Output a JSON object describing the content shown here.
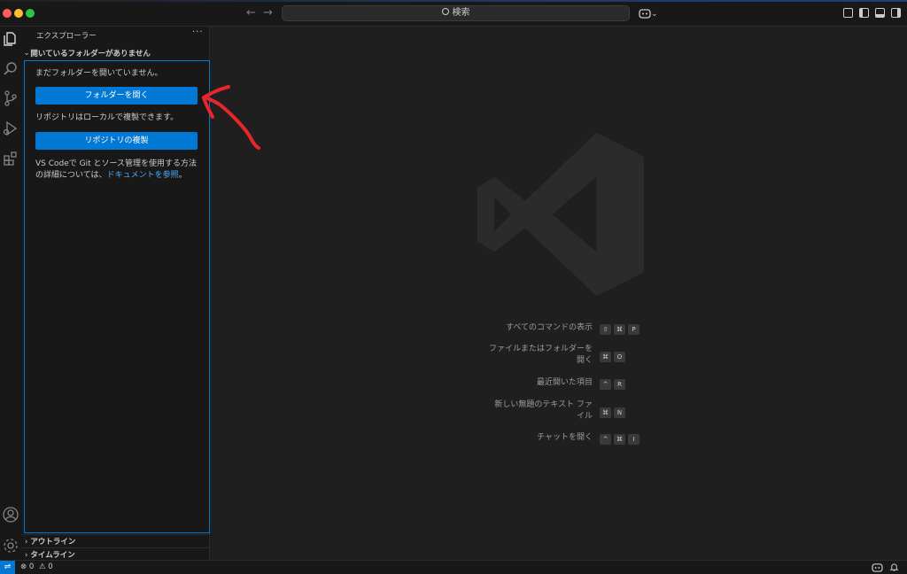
{
  "titlebar": {
    "search_label": "検索",
    "copilot_chevron": "⌄"
  },
  "sidebar": {
    "title": "エクスプローラー",
    "more": "···",
    "section_title": "開いているフォルダーがありません",
    "no_folder_msg": "まだフォルダーを開いていません。",
    "open_folder_button": "フォルダーを開く",
    "clone_msg": "リポジトリはローカルで複製できます。",
    "clone_button": "リポジトリの複製",
    "info_line1": "VS Codeで Git とソース管理を使用する方法",
    "info_line2_prefix": "の詳細については、",
    "info_link": "ドキュメントを参照",
    "info_suffix": "。",
    "outline": "アウトライン",
    "timeline": "タイムライン"
  },
  "editor": {
    "commands": [
      {
        "label": "すべてのコマンドの表示",
        "keys": [
          "⇧",
          "⌘",
          "P"
        ]
      },
      {
        "label_line1": "ファイルまたはフォルダーを",
        "label_line2": "開く",
        "keys": [
          "⌘",
          "O"
        ]
      },
      {
        "label": "最近開いた項目",
        "keys": [
          "^",
          "R"
        ]
      },
      {
        "label_line1": "新しい無題のテキスト ファ",
        "label_line2": "イル",
        "keys": [
          "⌘",
          "N"
        ]
      },
      {
        "label": "チャットを開く",
        "keys": [
          "^",
          "⌘",
          "I"
        ]
      }
    ]
  },
  "statusbar": {
    "errors": "0",
    "warnings": "0"
  },
  "colors": {
    "accent": "#0078d4",
    "link": "#4daafc",
    "annotation": "#e8252b"
  }
}
